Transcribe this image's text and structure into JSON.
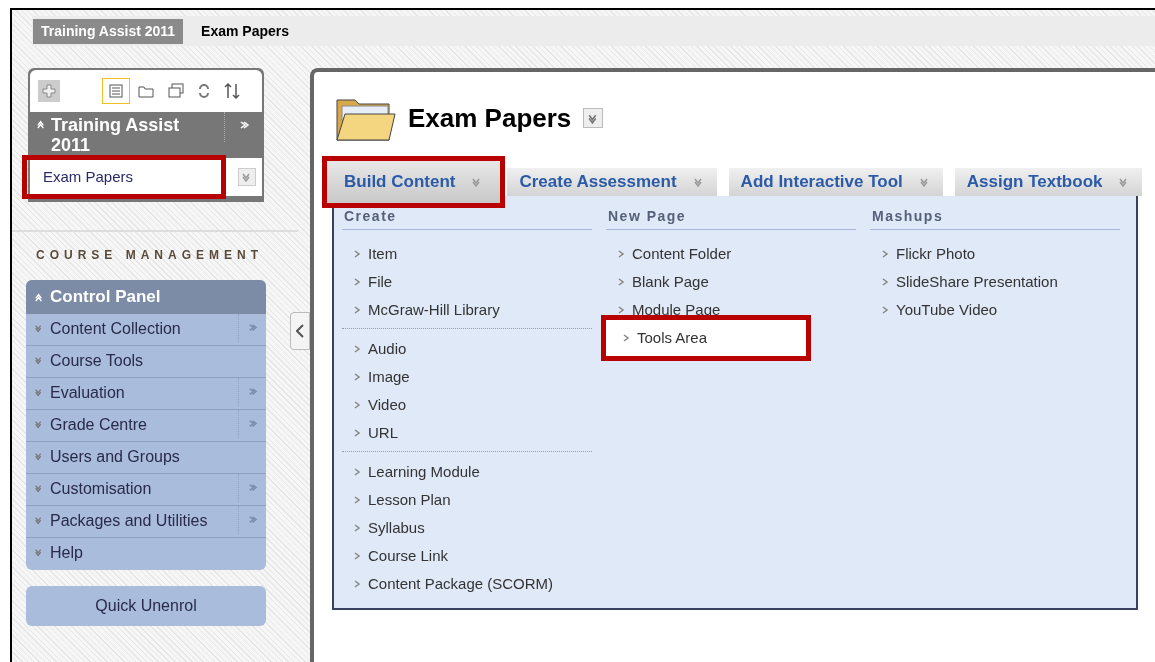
{
  "breadcrumbs": [
    {
      "label": "Training Assist 2011",
      "selected": true
    },
    {
      "label": "Exam Papers",
      "selected": false
    }
  ],
  "course_menu": {
    "views": [
      {
        "kind": "list",
        "selected": true
      },
      {
        "kind": "folder",
        "selected": false
      },
      {
        "kind": "windows",
        "selected": false
      }
    ],
    "title": "Training Assist 2011",
    "items": [
      {
        "label": "Exam Papers",
        "highlighted": true
      }
    ]
  },
  "course_management": {
    "heading": "COURSE MANAGEMENT",
    "panel_title": "Control Panel",
    "items": [
      {
        "label": "Content Collection",
        "has_submenu": true
      },
      {
        "label": "Course Tools",
        "has_submenu": false
      },
      {
        "label": "Evaluation",
        "has_submenu": true
      },
      {
        "label": "Grade Centre",
        "has_submenu": true
      },
      {
        "label": "Users and Groups",
        "has_submenu": false
      },
      {
        "label": "Customisation",
        "has_submenu": true
      },
      {
        "label": "Packages and Utilities",
        "has_submenu": true
      },
      {
        "label": "Help",
        "has_submenu": false
      }
    ],
    "quick_button": "Quick Unenrol"
  },
  "content": {
    "title": "Exam Papers",
    "action_buttons": [
      {
        "label": "Build Content",
        "selected": true,
        "highlighted": true
      },
      {
        "label": "Create Assessment",
        "selected": false,
        "highlighted": false
      },
      {
        "label": "Add Interactive Tool",
        "selected": false,
        "highlighted": false
      },
      {
        "label": "Assign Textbook",
        "selected": false,
        "highlighted": false
      }
    ],
    "menu_columns": [
      {
        "heading": "Create",
        "groups": [
          [
            {
              "label": "Item",
              "selected": false,
              "highlighted": false
            },
            {
              "label": "File",
              "selected": false,
              "highlighted": false
            },
            {
              "label": "McGraw-Hill Library",
              "selected": false,
              "highlighted": false
            }
          ],
          [
            {
              "label": "Audio",
              "selected": false,
              "highlighted": false
            },
            {
              "label": "Image",
              "selected": false,
              "highlighted": false
            },
            {
              "label": "Video",
              "selected": false,
              "highlighted": false
            },
            {
              "label": "URL",
              "selected": false,
              "highlighted": false
            }
          ],
          [
            {
              "label": "Learning Module",
              "selected": false,
              "highlighted": false
            },
            {
              "label": "Lesson Plan",
              "selected": false,
              "highlighted": false
            },
            {
              "label": "Syllabus",
              "selected": false,
              "highlighted": false
            },
            {
              "label": "Course Link",
              "selected": false,
              "highlighted": false
            },
            {
              "label": "Content Package (SCORM)",
              "selected": false,
              "highlighted": false
            }
          ]
        ]
      },
      {
        "heading": "New Page",
        "groups": [
          [
            {
              "label": "Content Folder",
              "selected": false,
              "highlighted": false
            },
            {
              "label": "Blank Page",
              "selected": false,
              "highlighted": false
            },
            {
              "label": "Module Page",
              "selected": false,
              "highlighted": false
            },
            {
              "label": "Tools Area",
              "selected": true,
              "highlighted": true
            }
          ]
        ]
      },
      {
        "heading": "Mashups",
        "groups": [
          [
            {
              "label": "Flickr Photo",
              "selected": false,
              "highlighted": false
            },
            {
              "label": "SlideShare Presentation",
              "selected": false,
              "highlighted": false
            },
            {
              "label": "YouTube Video",
              "selected": false,
              "highlighted": false
            }
          ]
        ]
      }
    ]
  }
}
